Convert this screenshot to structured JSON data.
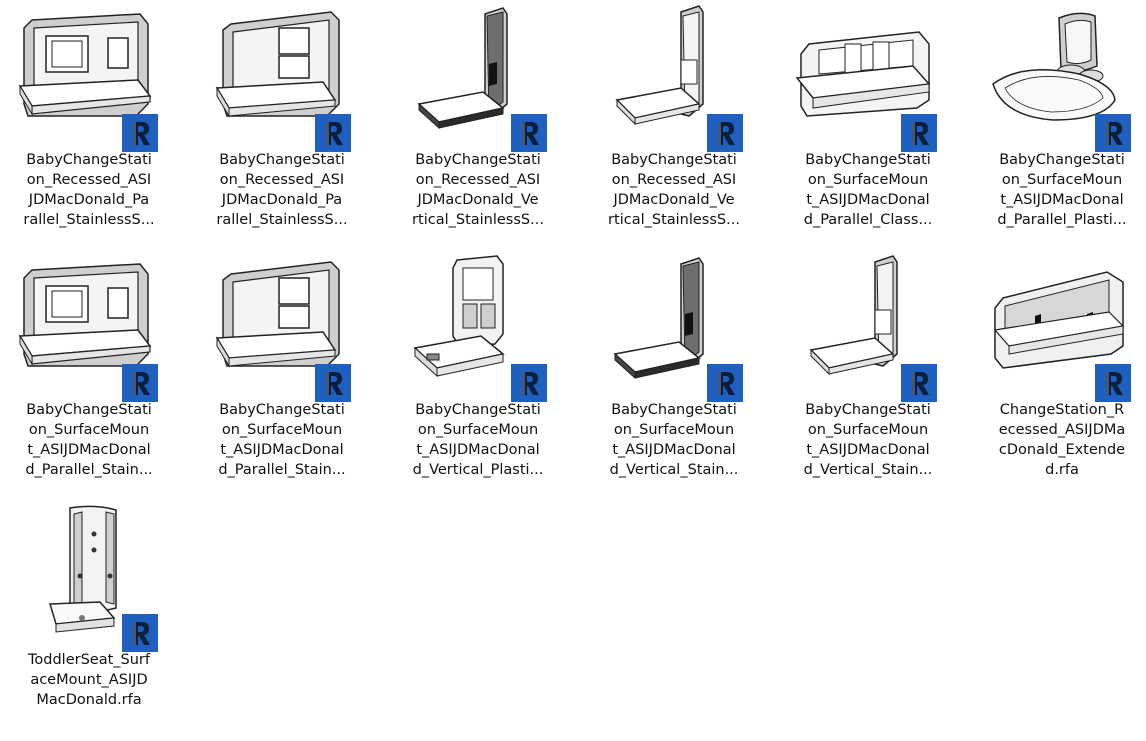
{
  "files": [
    {
      "name": "BabyChangeStation_Recessed_ASIJDMacDonald_Parallel_StainlessS...",
      "lines": [
        "BabyChangeStati",
        "on_Recessed_ASI",
        "JDMacDonald_Pa",
        "rallel_StainlessS..."
      ],
      "icon": "parallel-recessed"
    },
    {
      "name": "BabyChangeStation_Recessed_ASIJDMacDonald_Parallel_StainlessS...",
      "lines": [
        "BabyChangeStati",
        "on_Recessed_ASI",
        "JDMacDonald_Pa",
        "rallel_StainlessS..."
      ],
      "icon": "parallel-recessed-folded"
    },
    {
      "name": "BabyChangeStation_Recessed_ASIJDMacDonald_Vertical_StainlessS...",
      "lines": [
        "BabyChangeStati",
        "on_Recessed_ASI",
        "JDMacDonald_Ve",
        "rtical_StainlessS..."
      ],
      "icon": "vertical-dark"
    },
    {
      "name": "BabyChangeStation_Recessed_ASIJDMacDonald_Vertical_StainlessS...",
      "lines": [
        "BabyChangeStati",
        "on_Recessed_ASI",
        "JDMacDonald_Ve",
        "rtical_StainlessS..."
      ],
      "icon": "vertical-light"
    },
    {
      "name": "BabyChangeStation_SurfaceMount_ASIJDMacDonald_Parallel_Class...",
      "lines": [
        "BabyChangeStati",
        "on_SurfaceMoun",
        "t_ASIJDMacDonal",
        "d_Parallel_Class..."
      ],
      "icon": "parallel-surface-class"
    },
    {
      "name": "BabyChangeStation_SurfaceMount_ASIJDMacDonald_Parallel_Plasti...",
      "lines": [
        "BabyChangeStati",
        "on_SurfaceMoun",
        "t_ASIJDMacDonal",
        "d_Parallel_Plasti..."
      ],
      "icon": "parallel-plastic"
    },
    {
      "name": "BabyChangeStation_SurfaceMount_ASIJDMacDonald_Parallel_Stain...",
      "lines": [
        "BabyChangeStati",
        "on_SurfaceMoun",
        "t_ASIJDMacDonal",
        "d_Parallel_Stain..."
      ],
      "icon": "parallel-recessed"
    },
    {
      "name": "BabyChangeStation_SurfaceMount_ASIJDMacDonald_Parallel_Stain...",
      "lines": [
        "BabyChangeStati",
        "on_SurfaceMoun",
        "t_ASIJDMacDonal",
        "d_Parallel_Stain..."
      ],
      "icon": "parallel-recessed-folded"
    },
    {
      "name": "BabyChangeStation_SurfaceMount_ASIJDMacDonald_Vertical_Plasti...",
      "lines": [
        "BabyChangeStati",
        "on_SurfaceMoun",
        "t_ASIJDMacDonal",
        "d_Vertical_Plasti..."
      ],
      "icon": "vertical-plastic"
    },
    {
      "name": "BabyChangeStation_SurfaceMount_ASIJDMacDonald_Vertical_Stain...",
      "lines": [
        "BabyChangeStati",
        "on_SurfaceMoun",
        "t_ASIJDMacDonal",
        "d_Vertical_Stain..."
      ],
      "icon": "vertical-dark"
    },
    {
      "name": "BabyChangeStation_SurfaceMount_ASIJDMacDonald_Vertical_Stain...",
      "lines": [
        "BabyChangeStati",
        "on_SurfaceMoun",
        "t_ASIJDMacDonal",
        "d_Vertical_Stain..."
      ],
      "icon": "vertical-light"
    },
    {
      "name": "ChangeStation_Recessed_ASIJDMacDonald_Extended.rfa",
      "lines": [
        "ChangeStation_R",
        "ecessed_ASIJDMa",
        "cDonald_Extende",
        "d.rfa"
      ],
      "icon": "extended"
    },
    {
      "name": "ToddlerSeat_SurfaceMount_ASIJDMacDonald.rfa",
      "lines": [
        "ToddlerSeat_Surf",
        "aceMount_ASIJD",
        "MacDonald.rfa"
      ],
      "icon": "toddler-seat"
    }
  ],
  "badge": {
    "icon": "revit-family-icon",
    "color": "#1f5fbf"
  }
}
